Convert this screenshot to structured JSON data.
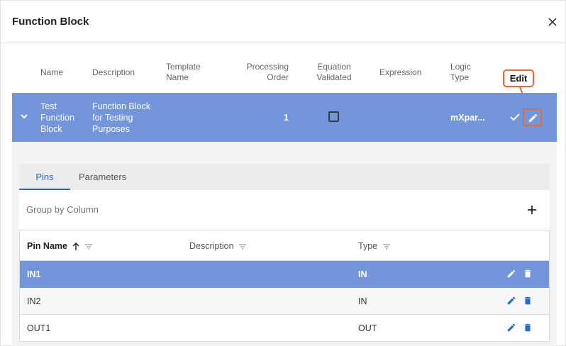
{
  "dialog": {
    "title": "Function Block",
    "close_icon": "close-icon"
  },
  "table": {
    "headers": {
      "name": "Name",
      "description": "Description",
      "template_name": "Template Name",
      "processing_order": "Processing Order",
      "equation_validated": "Equation Validated",
      "expression": "Expression",
      "logic_type": "Logic Type"
    },
    "row": {
      "name": "Test Function Block",
      "description": "Function Block for Testing Purposes",
      "template_name": "",
      "processing_order": "1",
      "equation_validated": false,
      "expression": "",
      "logic_type": "mXpar..."
    }
  },
  "callout": {
    "label": "Edit",
    "color": "#e8683a"
  },
  "detail": {
    "tabs": [
      {
        "label": "Pins",
        "active": true
      },
      {
        "label": "Parameters",
        "active": false
      }
    ],
    "group_by_label": "Group by Column",
    "grid": {
      "headers": {
        "pin_name": "Pin Name",
        "description": "Description",
        "type": "Type"
      },
      "rows": [
        {
          "pin_name": "IN1",
          "description": "",
          "type": "IN",
          "selected": true
        },
        {
          "pin_name": "IN2",
          "description": "",
          "type": "IN",
          "selected": false
        },
        {
          "pin_name": "OUT1",
          "description": "",
          "type": "OUT",
          "selected": false
        }
      ]
    }
  },
  "colors": {
    "row_highlight": "#7296d9",
    "accent": "#2268d6",
    "callout": "#e8683a"
  }
}
